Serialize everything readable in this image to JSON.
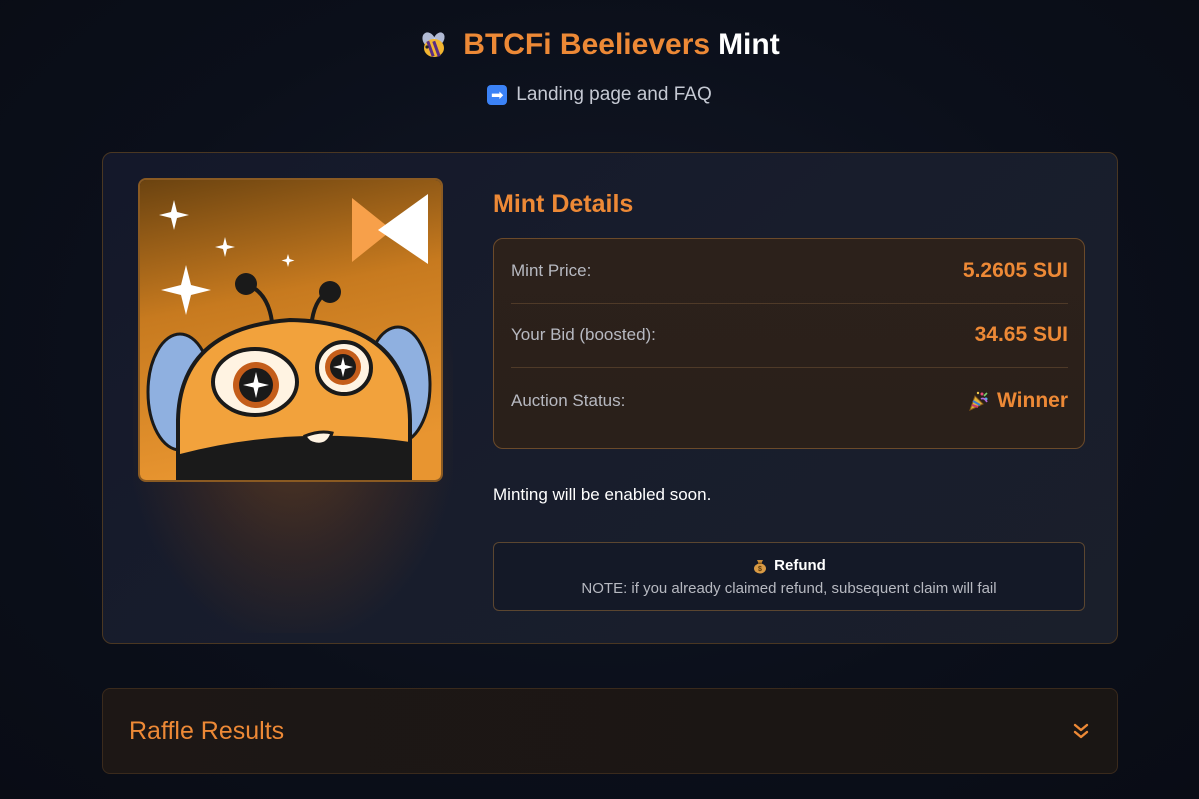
{
  "header": {
    "title_main": "BTCFi Beelievers",
    "title_mint": "Mint",
    "link_label": "Landing page and FAQ",
    "icons": [
      "bee-icon",
      "arrow-right-icon"
    ]
  },
  "mint_details": {
    "title": "Mint Details",
    "rows": [
      {
        "label": "Mint Price:",
        "value": "5.2605 SUI"
      },
      {
        "label": "Your Bid (boosted):",
        "value": "34.65 SUI"
      },
      {
        "label": "Auction Status:",
        "value": "Winner",
        "icon": "party-popper-icon"
      }
    ],
    "note": "Minting will be enabled soon.",
    "refund": {
      "label": "Refund",
      "icon": "money-bag-icon",
      "note": "NOTE: if you already claimed refund, subsequent claim will fail"
    }
  },
  "raffle": {
    "title": "Raffle Results",
    "icon": "double-chevron-down-icon"
  },
  "colors": {
    "accent": "#ed8936",
    "background": "#0b0f1a",
    "card_border": "#4a3722",
    "link_icon": "#3b82f6"
  }
}
